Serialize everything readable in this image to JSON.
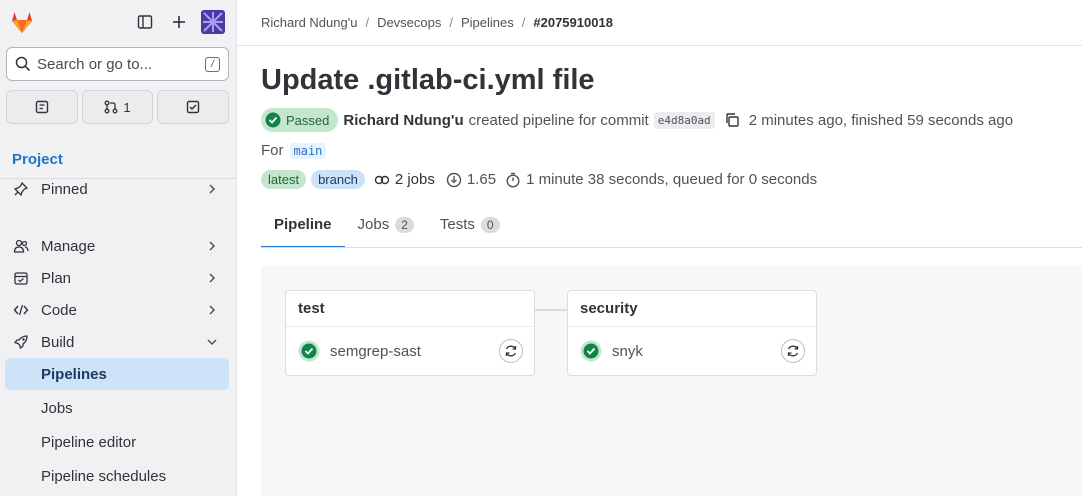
{
  "sidebar": {
    "search_label": "Search or go to...",
    "search_kbd": "/",
    "counters": [
      {
        "icon": "issues-icon",
        "label": ""
      },
      {
        "icon": "merge-request-icon",
        "label": "1"
      },
      {
        "icon": "todo-icon",
        "label": ""
      }
    ],
    "section_title": "Project",
    "items": [
      {
        "label": "Pinned",
        "icon": "pin-icon"
      },
      {
        "label": "Manage",
        "icon": "users-icon"
      },
      {
        "label": "Plan",
        "icon": "calendar-icon"
      },
      {
        "label": "Code",
        "icon": "code-icon"
      },
      {
        "label": "Build",
        "icon": "rocket-icon"
      }
    ],
    "build_subitems": [
      "Pipelines",
      "Jobs",
      "Pipeline editor",
      "Pipeline schedules"
    ]
  },
  "breadcrumb": [
    "Richard Ndung'u",
    "Devsecops",
    "Pipelines",
    "#2075910018"
  ],
  "title": "Update .gitlab-ci.yml file",
  "status": "Passed",
  "author": "Richard Ndung'u",
  "created_text": "created pipeline for commit",
  "commit_sha": "e4d8a0ad",
  "timing_text": "2 minutes ago, finished 59 seconds ago",
  "for_label": "For",
  "branch_ref": "main",
  "badges": {
    "latest": "latest",
    "branch": "branch"
  },
  "jobs_count_text": "2 jobs",
  "compute_minutes": "1.65",
  "duration_text": "1 minute 38 seconds, queued for 0 seconds",
  "tabs": [
    {
      "label": "Pipeline",
      "count": null
    },
    {
      "label": "Jobs",
      "count": "2"
    },
    {
      "label": "Tests",
      "count": "0"
    }
  ],
  "stages": [
    {
      "name": "test",
      "job": "semgrep-sast"
    },
    {
      "name": "security",
      "job": "snyk"
    }
  ],
  "colors": {
    "accent": "#1f75cb",
    "success": "#108548"
  }
}
